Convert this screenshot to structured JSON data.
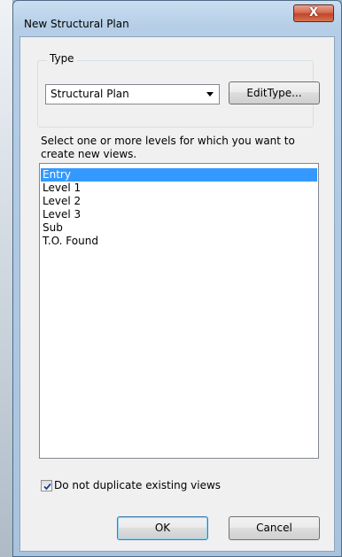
{
  "window": {
    "title": "New Structural Plan",
    "close_label": "X"
  },
  "type_group": {
    "label": "Type",
    "selected_type": "Structural Plan",
    "edit_type_label": "EditType..."
  },
  "instructions": "Select one or more levels for which you want to create new views.",
  "levels": [
    {
      "label": "Entry",
      "selected": true
    },
    {
      "label": "Level 1",
      "selected": false
    },
    {
      "label": "Level 2",
      "selected": false
    },
    {
      "label": "Level 3",
      "selected": false
    },
    {
      "label": "Sub",
      "selected": false
    },
    {
      "label": "T.O. Found",
      "selected": false
    }
  ],
  "options": {
    "do_not_duplicate_label": "Do not duplicate existing views",
    "do_not_duplicate_checked": true
  },
  "buttons": {
    "ok_label": "OK",
    "cancel_label": "Cancel"
  },
  "colors": {
    "selection": "#3399ff",
    "close_button": "#c0452c"
  }
}
